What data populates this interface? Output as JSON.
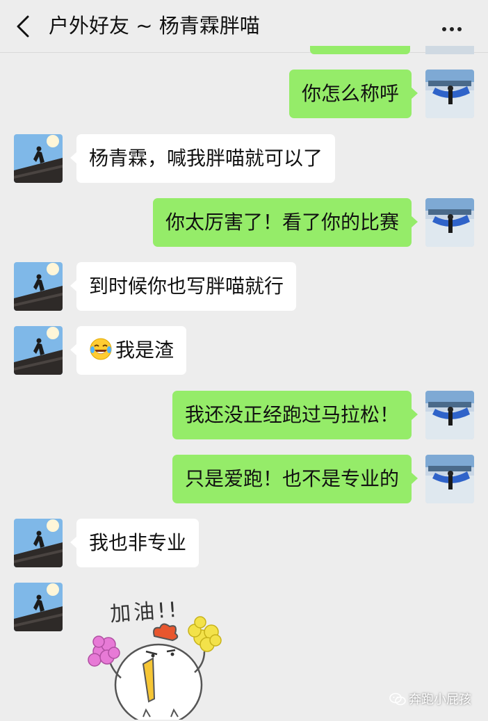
{
  "header": {
    "title": "户外好友 ~ 杨青霖胖喵",
    "back_icon": "chevron-left-icon",
    "more_icon": "more-dots-icon"
  },
  "messages": [
    {
      "side": "right",
      "text": "你怎么称呼"
    },
    {
      "side": "left",
      "text": "杨青霖，喊我胖喵就可以了"
    },
    {
      "side": "right",
      "text": "你太厉害了！看了你的比赛"
    },
    {
      "side": "left",
      "text": "到时候你也写胖喵就行"
    },
    {
      "side": "left",
      "text": "我是渣",
      "emoji": "tears-of-joy-emoji"
    },
    {
      "side": "right",
      "text": "我还没正经跑过马拉松！"
    },
    {
      "side": "right",
      "text": "只是爱跑！也不是专业的"
    },
    {
      "side": "left",
      "text": "我也非专业"
    },
    {
      "side": "left",
      "sticker": "cheering-chick-sticker"
    }
  ],
  "sticker": {
    "caption": "加油!!"
  },
  "watermark": {
    "text": "奔跑小屁孩",
    "icon": "wechat-icon"
  },
  "colors": {
    "background": "#ededed",
    "outgoing_bubble": "#95ec69",
    "incoming_bubble": "#ffffff"
  }
}
